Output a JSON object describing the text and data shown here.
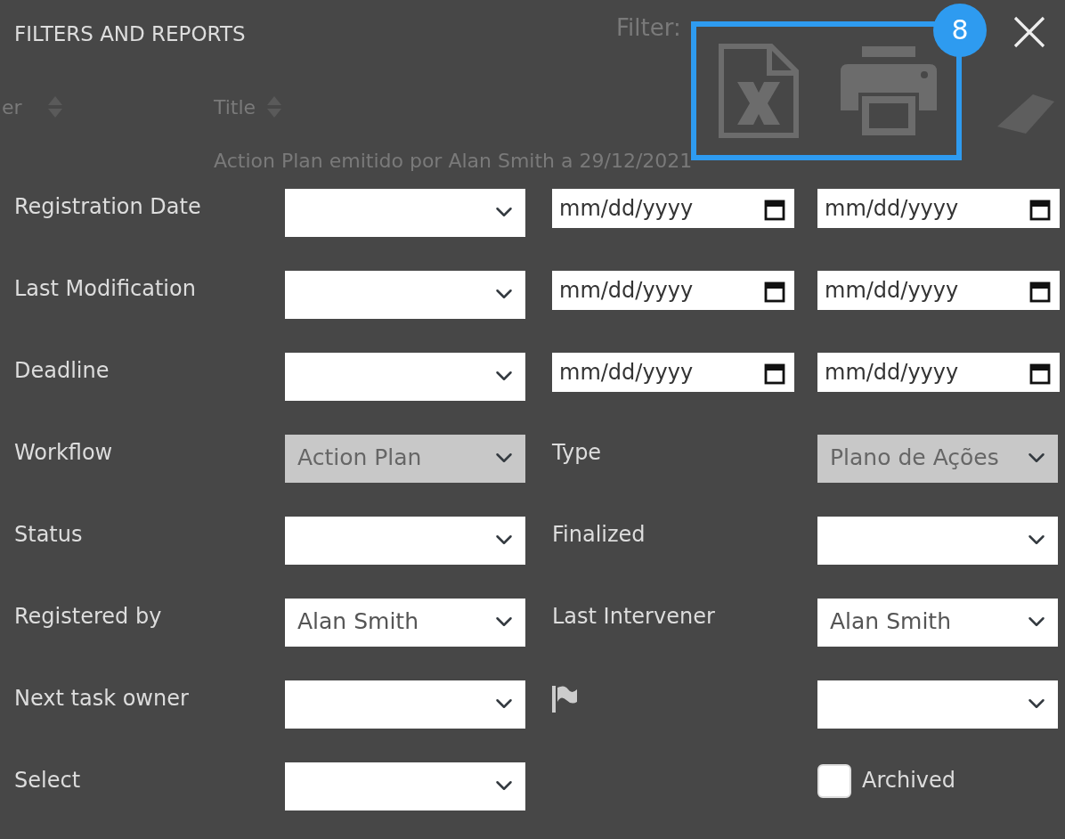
{
  "background_page": {
    "filter_label": "Filter:",
    "columns": [
      "er",
      "Title"
    ],
    "row_text": "Action Plan emitido por Alan Smith a 29/12/2021"
  },
  "dialog": {
    "title": "FILTERS AND REPORTS",
    "export_badge": "8"
  },
  "rows": [
    {
      "kind": "date_range",
      "label": "Registration Date",
      "select": {
        "disabled": false
      },
      "from": {
        "placeholder": "mm/dd/yyyy"
      },
      "to": {
        "placeholder": "mm/dd/yyyy"
      }
    },
    {
      "kind": "date_range",
      "label": "Last Modification",
      "select": {
        "disabled": false
      },
      "from": {
        "placeholder": "mm/dd/yyyy"
      },
      "to": {
        "placeholder": "mm/dd/yyyy"
      }
    },
    {
      "kind": "date_range",
      "label": "Deadline",
      "select": {
        "disabled": false
      },
      "from": {
        "placeholder": "mm/dd/yyyy"
      },
      "to": {
        "placeholder": "mm/dd/yyyy"
      }
    },
    {
      "kind": "pair",
      "label": "Workflow",
      "select": {
        "value": "Action Plan",
        "disabled": true
      },
      "label2": "Type",
      "select2": {
        "value": "Plano de Ações",
        "disabled": true
      }
    },
    {
      "kind": "pair",
      "label": "Status",
      "select": {
        "disabled": false
      },
      "label2": "Finalized",
      "select2": {
        "disabled": false
      }
    },
    {
      "kind": "pair",
      "label": "Registered by",
      "select": {
        "value": "Alan Smith",
        "disabled": false
      },
      "label2": "Last Intervener",
      "select2": {
        "value": "Alan Smith",
        "disabled": false
      }
    },
    {
      "kind": "flag",
      "label": "Next task owner",
      "select": {
        "disabled": false
      },
      "select2": {
        "disabled": false
      }
    },
    {
      "kind": "checkbox",
      "label": "Select",
      "select": {
        "disabled": false
      },
      "checkbox": {
        "label": "Archived",
        "checked": false
      }
    }
  ]
}
